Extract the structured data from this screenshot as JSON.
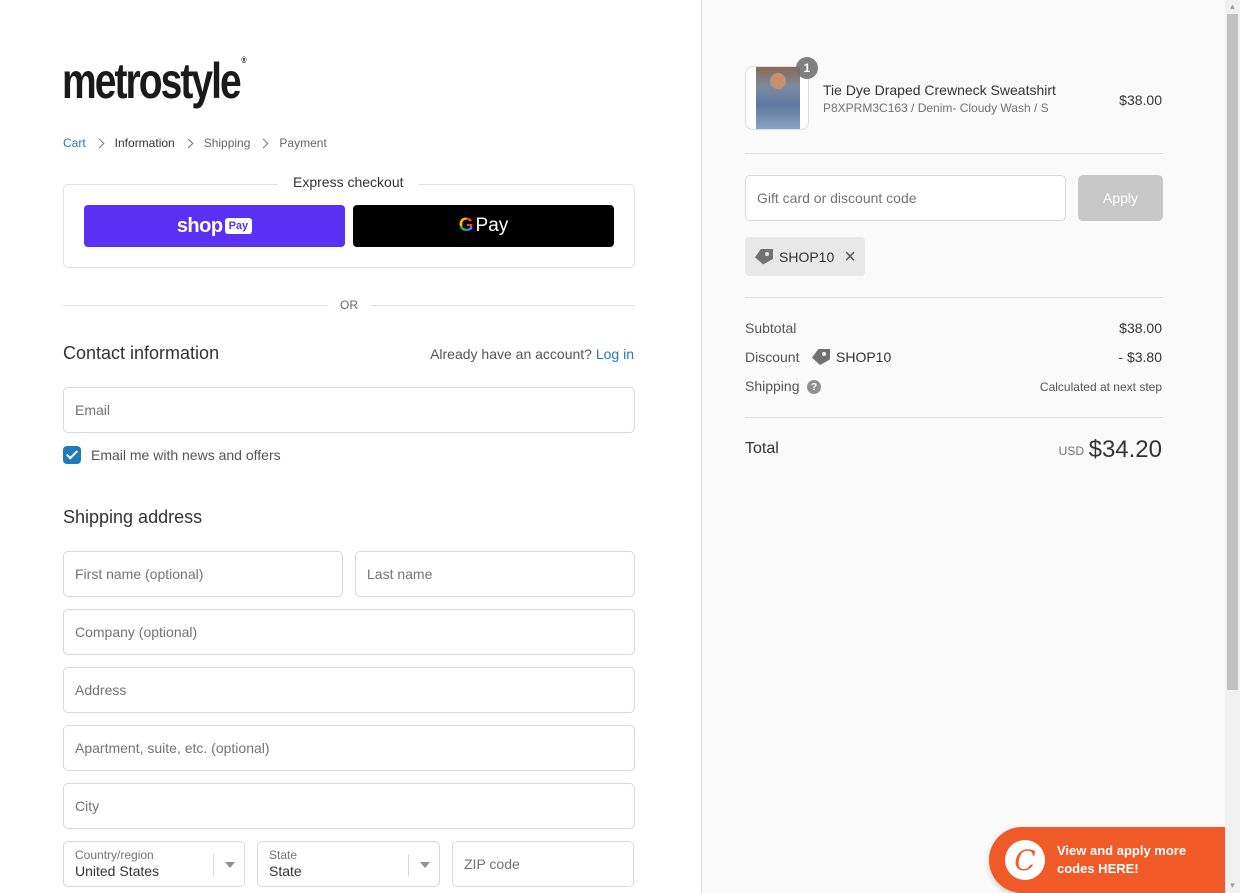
{
  "brand": {
    "logo": "metrostyle",
    "logo_mark": "®"
  },
  "breadcrumb": {
    "cart": "Cart",
    "information": "Information",
    "shipping": "Shipping",
    "payment": "Payment"
  },
  "express": {
    "title": "Express checkout",
    "shop_pay": {
      "shop": "shop",
      "pay": "Pay"
    },
    "gpay": {
      "g": "G",
      "pay": "Pay"
    },
    "or": "OR"
  },
  "contact": {
    "title": "Contact information",
    "account_prompt": "Already have an account?",
    "login": "Log in",
    "email_placeholder": "Email",
    "newsletter_label": "Email me with news and offers",
    "newsletter_checked": true
  },
  "shipping_address": {
    "title": "Shipping address",
    "first_name": "First name (optional)",
    "last_name": "Last name",
    "company": "Company (optional)",
    "address": "Address",
    "apartment": "Apartment, suite, etc. (optional)",
    "city": "City",
    "country_label": "Country/region",
    "country_value": "United States",
    "state_label": "State",
    "state_value": "State",
    "zip": "ZIP code"
  },
  "order": {
    "item": {
      "quantity": "1",
      "name": "Tie Dye Draped Crewneck Sweatshirt",
      "variant": "P8XPRM3C163 / Denim- Cloudy Wash / S",
      "price": "$38.00"
    },
    "gift_placeholder": "Gift card or discount code",
    "apply": "Apply",
    "applied_code": "SHOP10",
    "subtotal_label": "Subtotal",
    "subtotal": "$38.00",
    "discount_label": "Discount",
    "discount_code": "SHOP10",
    "discount": "- $3.80",
    "shipping_label": "Shipping",
    "shipping_note": "Calculated at next step",
    "total_label": "Total",
    "currency": "USD",
    "total": "$34.20"
  },
  "promo": {
    "logo": "C",
    "text": "View and apply more codes HERE!"
  },
  "colors": {
    "accent": "#1f7ab8",
    "shop_pay": "#5a31f4",
    "promo": "#f05a28"
  }
}
